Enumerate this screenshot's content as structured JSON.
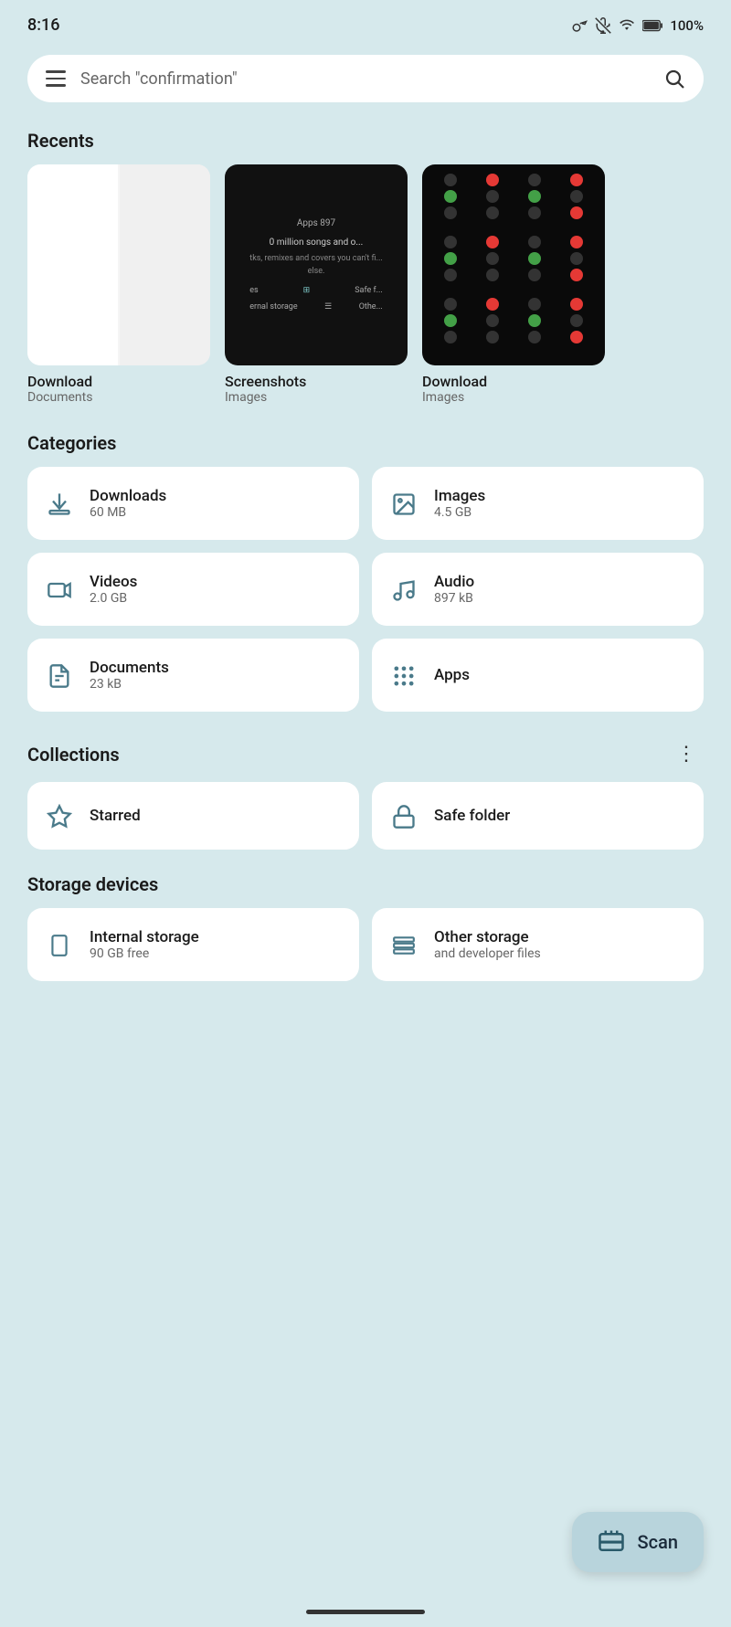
{
  "status": {
    "time": "8:16",
    "battery": "100%",
    "icons": [
      "key",
      "mute",
      "wifi",
      "battery"
    ]
  },
  "search": {
    "placeholder": "Search \"confirmation\"",
    "hamburger_label": "Menu",
    "search_icon_label": "Search"
  },
  "recents": {
    "title": "Recents",
    "items": [
      {
        "name": "Download",
        "type": "Documents"
      },
      {
        "name": "Screenshots",
        "type": "Images"
      },
      {
        "name": "Download",
        "type": "Images"
      }
    ]
  },
  "categories": {
    "title": "Categories",
    "items": [
      {
        "id": "downloads",
        "label": "Downloads",
        "sub": "60 MB",
        "icon": "download"
      },
      {
        "id": "images",
        "label": "Images",
        "sub": "4.5 GB",
        "icon": "image"
      },
      {
        "id": "videos",
        "label": "Videos",
        "sub": "2.0 GB",
        "icon": "video"
      },
      {
        "id": "audio",
        "label": "Audio",
        "sub": "897 kB",
        "icon": "audio"
      },
      {
        "id": "documents",
        "label": "Documents",
        "sub": "23 kB",
        "icon": "document"
      },
      {
        "id": "apps",
        "label": "Apps",
        "sub": "",
        "icon": "apps"
      }
    ]
  },
  "collections": {
    "title": "Collections",
    "more_label": "⋮",
    "items": [
      {
        "id": "starred",
        "label": "Starred",
        "sub": "",
        "icon": "star"
      },
      {
        "id": "safe-folder",
        "label": "Safe folder",
        "sub": "",
        "icon": "lock"
      }
    ]
  },
  "storage": {
    "title": "Storage devices",
    "items": [
      {
        "id": "internal",
        "label": "Internal storage",
        "sub": "90 GB free",
        "icon": "phone"
      },
      {
        "id": "other",
        "label": "Other storage",
        "sub": "and developer files",
        "icon": "layers"
      }
    ]
  },
  "scan": {
    "label": "Scan",
    "icon": "scan"
  }
}
